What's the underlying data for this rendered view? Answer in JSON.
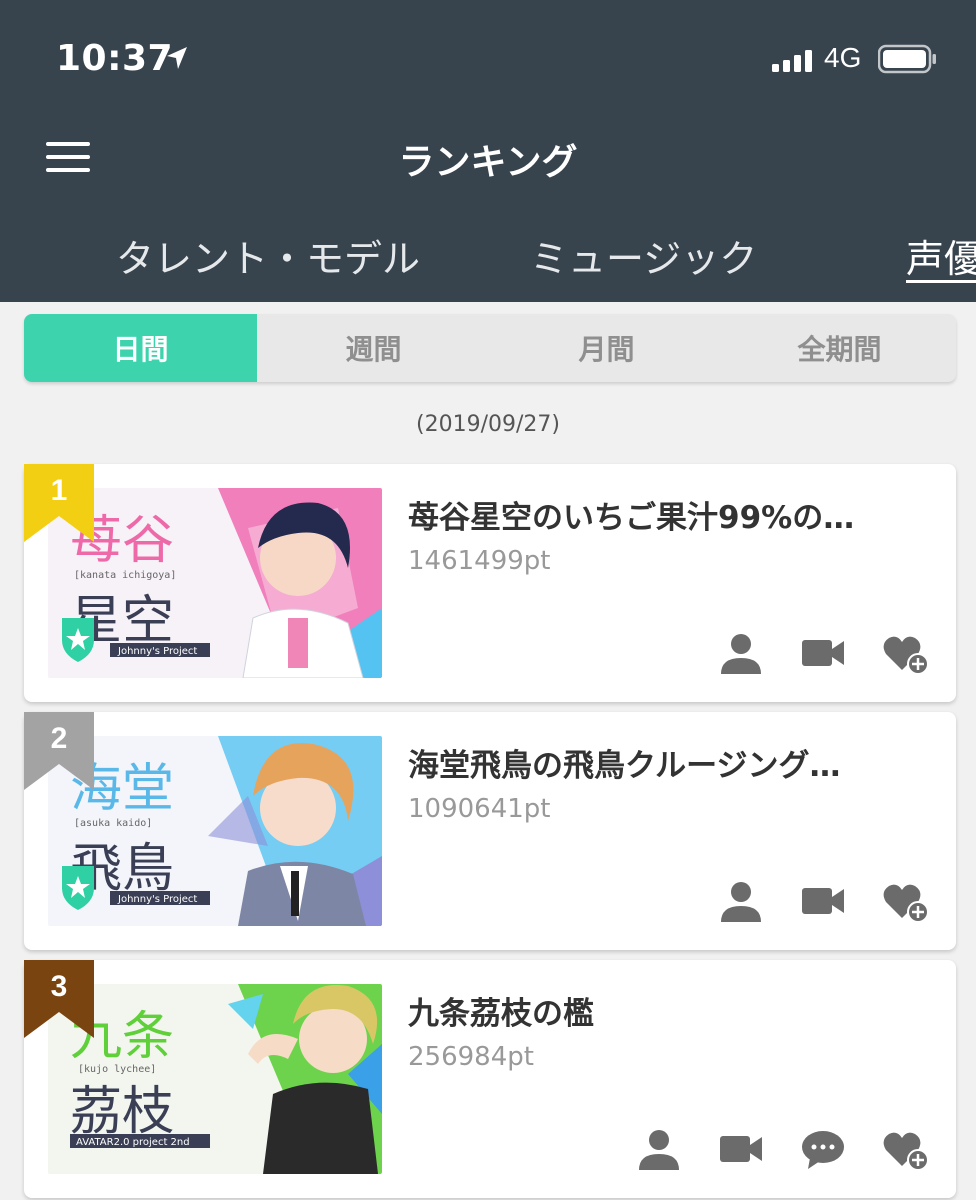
{
  "status": {
    "time": "10:37",
    "network": "4G"
  },
  "header": {
    "title": "ランキング",
    "menu_icon": "hamburger-menu-icon"
  },
  "category_tabs": [
    {
      "label": "タレント・モデル"
    },
    {
      "label": "ミュージック"
    },
    {
      "label": "声優"
    }
  ],
  "active_category": "声優",
  "period_tabs": [
    {
      "label": "日間"
    },
    {
      "label": "週間"
    },
    {
      "label": "月間"
    },
    {
      "label": "全期間"
    }
  ],
  "active_period": "日間",
  "date": "(2019/09/27)",
  "rankings": [
    {
      "rank": "1",
      "title": "苺谷星空のいちご果汁99%の…",
      "points": "1461499pt",
      "badge_color": "#f2cf12",
      "thumb": {
        "name_top": "苺谷",
        "name_bottom": "星空",
        "romaji": "[kanata ichigoya]",
        "label": "Johnny's Project",
        "accent": "#e9539a",
        "accent2": "#55c3f2"
      },
      "actions": [
        "profile-icon",
        "video-icon",
        "favorite-add-icon"
      ]
    },
    {
      "rank": "2",
      "title": "海堂飛鳥の飛鳥クルージング…",
      "points": "1090641pt",
      "badge_color": "#a3a3a3",
      "thumb": {
        "name_top": "海堂",
        "name_bottom": "飛鳥",
        "romaji": "[asuka kaido]",
        "label": "Johnny's Project",
        "accent": "#55c3f2",
        "accent2": "#8d8fd8"
      },
      "actions": [
        "profile-icon",
        "video-icon",
        "favorite-add-icon"
      ]
    },
    {
      "rank": "3",
      "title": "九条茘枝の檻",
      "points": "256984pt",
      "badge_color": "#7a4410",
      "thumb": {
        "name_top": "九条",
        "name_bottom": "茘枝",
        "romaji": "[kujo lychee]",
        "label": "AVATAR2.0 project 2nd",
        "accent": "#66d12e",
        "accent2": "#3aa0e8"
      },
      "actions": [
        "profile-icon",
        "video-icon",
        "chat-icon",
        "favorite-add-icon"
      ]
    }
  ],
  "colors": {
    "header_bg": "#37434d",
    "accent": "#3dd3ad",
    "page_bg": "#f1f1f1"
  }
}
